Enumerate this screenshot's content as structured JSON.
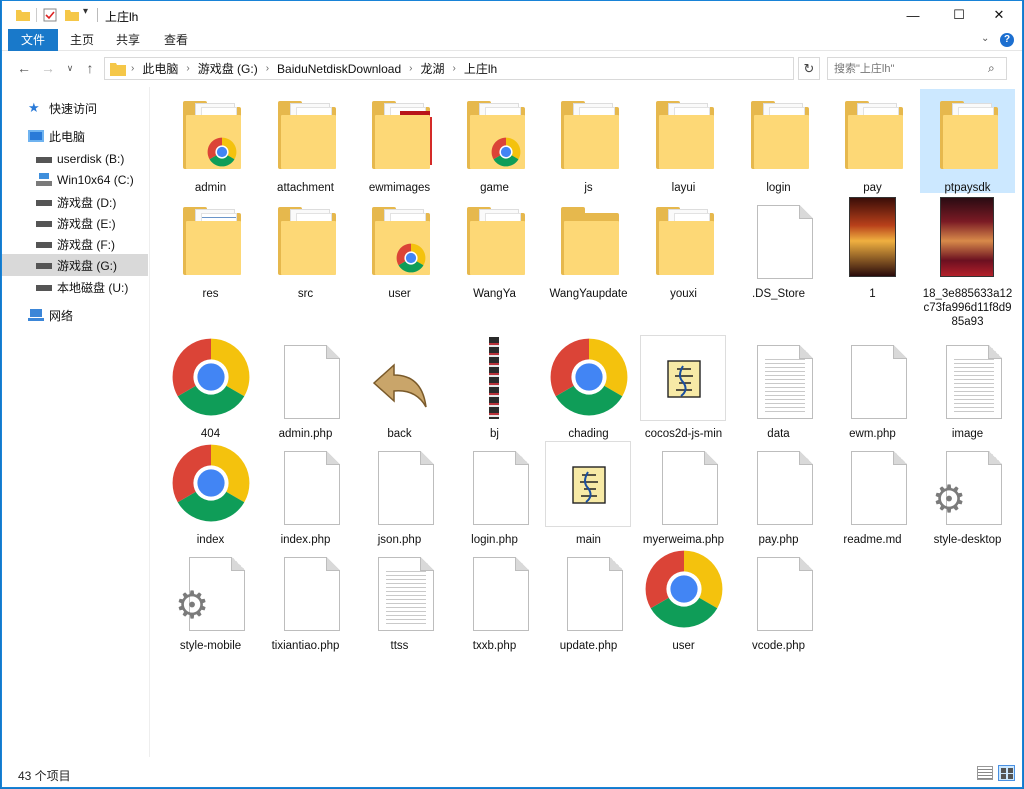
{
  "window": {
    "title": "上庄lh",
    "controls": {
      "minimize": "—",
      "maximize": "☐",
      "close": "✕"
    }
  },
  "ribbon": {
    "tabs": [
      "文件",
      "主页",
      "共享",
      "查看"
    ],
    "help": "?"
  },
  "address": {
    "crumbs": [
      "此电脑",
      "游戏盘 (G:)",
      "BaiduNetdiskDownload",
      "龙湖",
      "上庄lh"
    ],
    "search_placeholder": "搜索\"上庄lh\""
  },
  "sidebar": {
    "items": [
      {
        "label": "快速访问",
        "icon": "star-icon"
      },
      {
        "label": "此电脑",
        "icon": "computer-icon"
      },
      {
        "label": "userdisk (B:)",
        "icon": "drive-icon"
      },
      {
        "label": "Win10x64 (C:)",
        "icon": "system-drive-icon"
      },
      {
        "label": "游戏盘 (D:)",
        "icon": "drive-icon"
      },
      {
        "label": "游戏盘 (E:)",
        "icon": "drive-icon"
      },
      {
        "label": "游戏盘 (F:)",
        "icon": "drive-icon"
      },
      {
        "label": "游戏盘 (G:)",
        "icon": "drive-icon",
        "selected": true
      },
      {
        "label": "本地磁盘 (U:)",
        "icon": "drive-icon"
      },
      {
        "label": "网络",
        "icon": "network-icon"
      }
    ]
  },
  "files": [
    {
      "name": "admin",
      "type": "folder",
      "overlay": "chrome"
    },
    {
      "name": "attachment",
      "type": "folder"
    },
    {
      "name": "ewmimages",
      "type": "folder",
      "overlay": "red"
    },
    {
      "name": "game",
      "type": "folder",
      "overlay": "chrome"
    },
    {
      "name": "js",
      "type": "folder",
      "overlay": "scroll"
    },
    {
      "name": "layui",
      "type": "folder",
      "overlay": "scroll"
    },
    {
      "name": "login",
      "type": "folder"
    },
    {
      "name": "pay",
      "type": "folder"
    },
    {
      "name": "ptpaysdk",
      "type": "folder",
      "selected": true
    },
    {
      "name": "res",
      "type": "folder",
      "overlay": "blue-doc"
    },
    {
      "name": "src",
      "type": "folder",
      "overlay": "scroll"
    },
    {
      "name": "user",
      "type": "folder",
      "overlay": "chrome"
    },
    {
      "name": "WangYa",
      "type": "folder"
    },
    {
      "name": "WangYaupdate",
      "type": "folder-empty"
    },
    {
      "name": "youxi",
      "type": "folder"
    },
    {
      "name": ".DS_Store",
      "type": "file"
    },
    {
      "name": "1",
      "type": "image-dark"
    },
    {
      "name": "18_3e885633a12c73fa996d11f8d985a93",
      "type": "image-poster"
    },
    {
      "name": "404",
      "type": "chrome"
    },
    {
      "name": "admin.php",
      "type": "file"
    },
    {
      "name": "back",
      "type": "back-arrow"
    },
    {
      "name": "bj",
      "type": "image-strip"
    },
    {
      "name": "chading",
      "type": "chrome"
    },
    {
      "name": "cocos2d-js-min",
      "type": "script"
    },
    {
      "name": "data",
      "type": "text"
    },
    {
      "name": "ewm.php",
      "type": "file"
    },
    {
      "name": "image",
      "type": "text"
    },
    {
      "name": "index",
      "type": "chrome"
    },
    {
      "name": "index.php",
      "type": "file"
    },
    {
      "name": "json.php",
      "type": "file"
    },
    {
      "name": "login.php",
      "type": "file"
    },
    {
      "name": "main",
      "type": "script"
    },
    {
      "name": "myerweima.php",
      "type": "file"
    },
    {
      "name": "pay.php",
      "type": "file"
    },
    {
      "name": "readme.md",
      "type": "file"
    },
    {
      "name": "style-desktop",
      "type": "gear"
    },
    {
      "name": "style-mobile",
      "type": "gear"
    },
    {
      "name": "tixiantiao.php",
      "type": "file"
    },
    {
      "name": "ttss",
      "type": "text"
    },
    {
      "name": "txxb.php",
      "type": "file"
    },
    {
      "name": "update.php",
      "type": "file"
    },
    {
      "name": "user",
      "type": "chrome"
    },
    {
      "name": "vcode.php",
      "type": "file"
    }
  ],
  "status": {
    "count": "43 个项目"
  },
  "colors": {
    "accent": "#1979ca",
    "folder": "#fbd678",
    "selection": "#cce8ff"
  }
}
